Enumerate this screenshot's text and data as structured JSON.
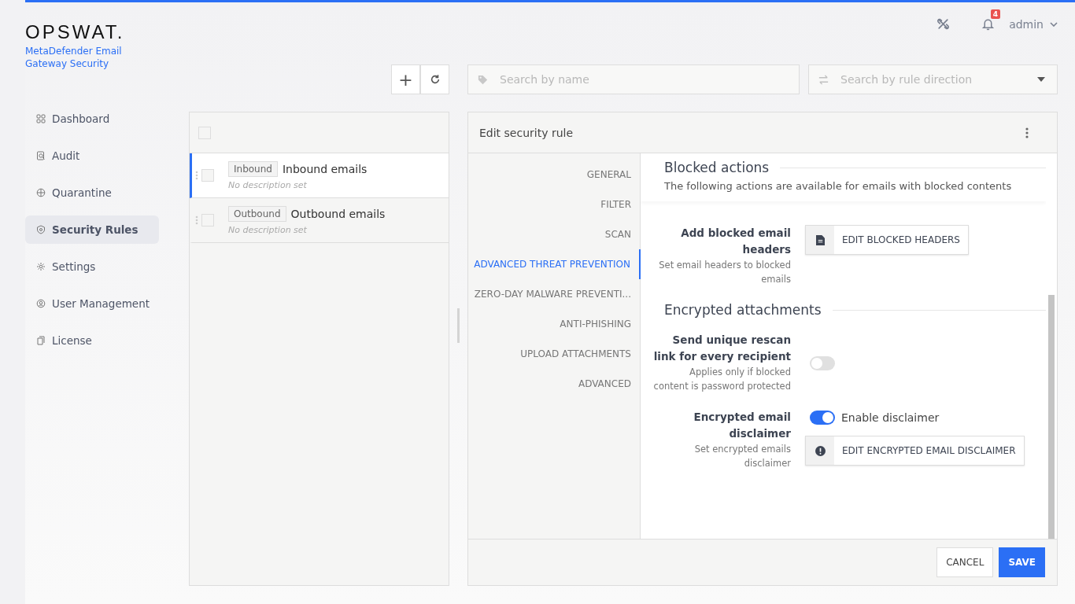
{
  "brand": {
    "logo": "OPSWAT.",
    "product": "MetaDefender Email Gateway Security"
  },
  "topbar": {
    "notifications": "4",
    "user": "admin"
  },
  "nav": [
    {
      "label": "Dashboard",
      "selected": false
    },
    {
      "label": "Audit",
      "selected": false
    },
    {
      "label": "Quarantine",
      "selected": false
    },
    {
      "label": "Security Rules",
      "selected": true
    },
    {
      "label": "Settings",
      "selected": false
    },
    {
      "label": "User Management",
      "selected": false
    },
    {
      "label": "License",
      "selected": false
    }
  ],
  "toolbar": {
    "add": "+",
    "search": {
      "placeholder": "Search by name"
    },
    "direction": {
      "placeholder": "Search by rule direction"
    }
  },
  "rules": {
    "select_all": {
      "checked": false
    },
    "items": [
      {
        "tag": "Inbound",
        "name": "Inbound emails",
        "description": "No description set",
        "selected": true,
        "checked": false
      },
      {
        "tag": "Outbound",
        "name": "Outbound emails",
        "description": "No description set",
        "selected": false,
        "checked": false
      }
    ]
  },
  "editor": {
    "title": "Edit security rule",
    "tabs": [
      {
        "label": "GENERAL",
        "selected": false
      },
      {
        "label": "FILTER",
        "selected": false
      },
      {
        "label": "SCAN",
        "selected": false
      },
      {
        "label": "ADVANCED THREAT PREVENTION",
        "selected": true
      },
      {
        "label": "ZERO-DAY MALWARE PREVENTI...",
        "selected": false
      },
      {
        "label": "ANTI-PHISHING",
        "selected": false
      },
      {
        "label": "UPLOAD ATTACHMENTS",
        "selected": false
      },
      {
        "label": "ADVANCED",
        "selected": false
      }
    ],
    "sticky": {
      "title": "Blocked actions",
      "subtitle": "The following actions are available for emails with blocked contents"
    },
    "sections": [
      {
        "rows": [
          {
            "kind": "button",
            "label": "Add blocked email headers",
            "description": "Set email headers to blocked emails",
            "button": "EDIT BLOCKED HEADERS"
          }
        ]
      },
      {
        "title": "Encrypted attachments",
        "rows": [
          {
            "kind": "toggle",
            "label": "Send unique rescan link for every recipient",
            "description": "Applies only if blocked content is password protected",
            "on": false
          },
          {
            "kind": "toggle-button",
            "label": "Encrypted email disclaimer",
            "description": "Set encrypted emails disclaimer",
            "on": true,
            "toggle_label": "Enable disclaimer",
            "button": "EDIT ENCRYPTED EMAIL DISCLAIMER"
          }
        ]
      }
    ],
    "cancel": "CANCEL",
    "save": "SAVE"
  }
}
